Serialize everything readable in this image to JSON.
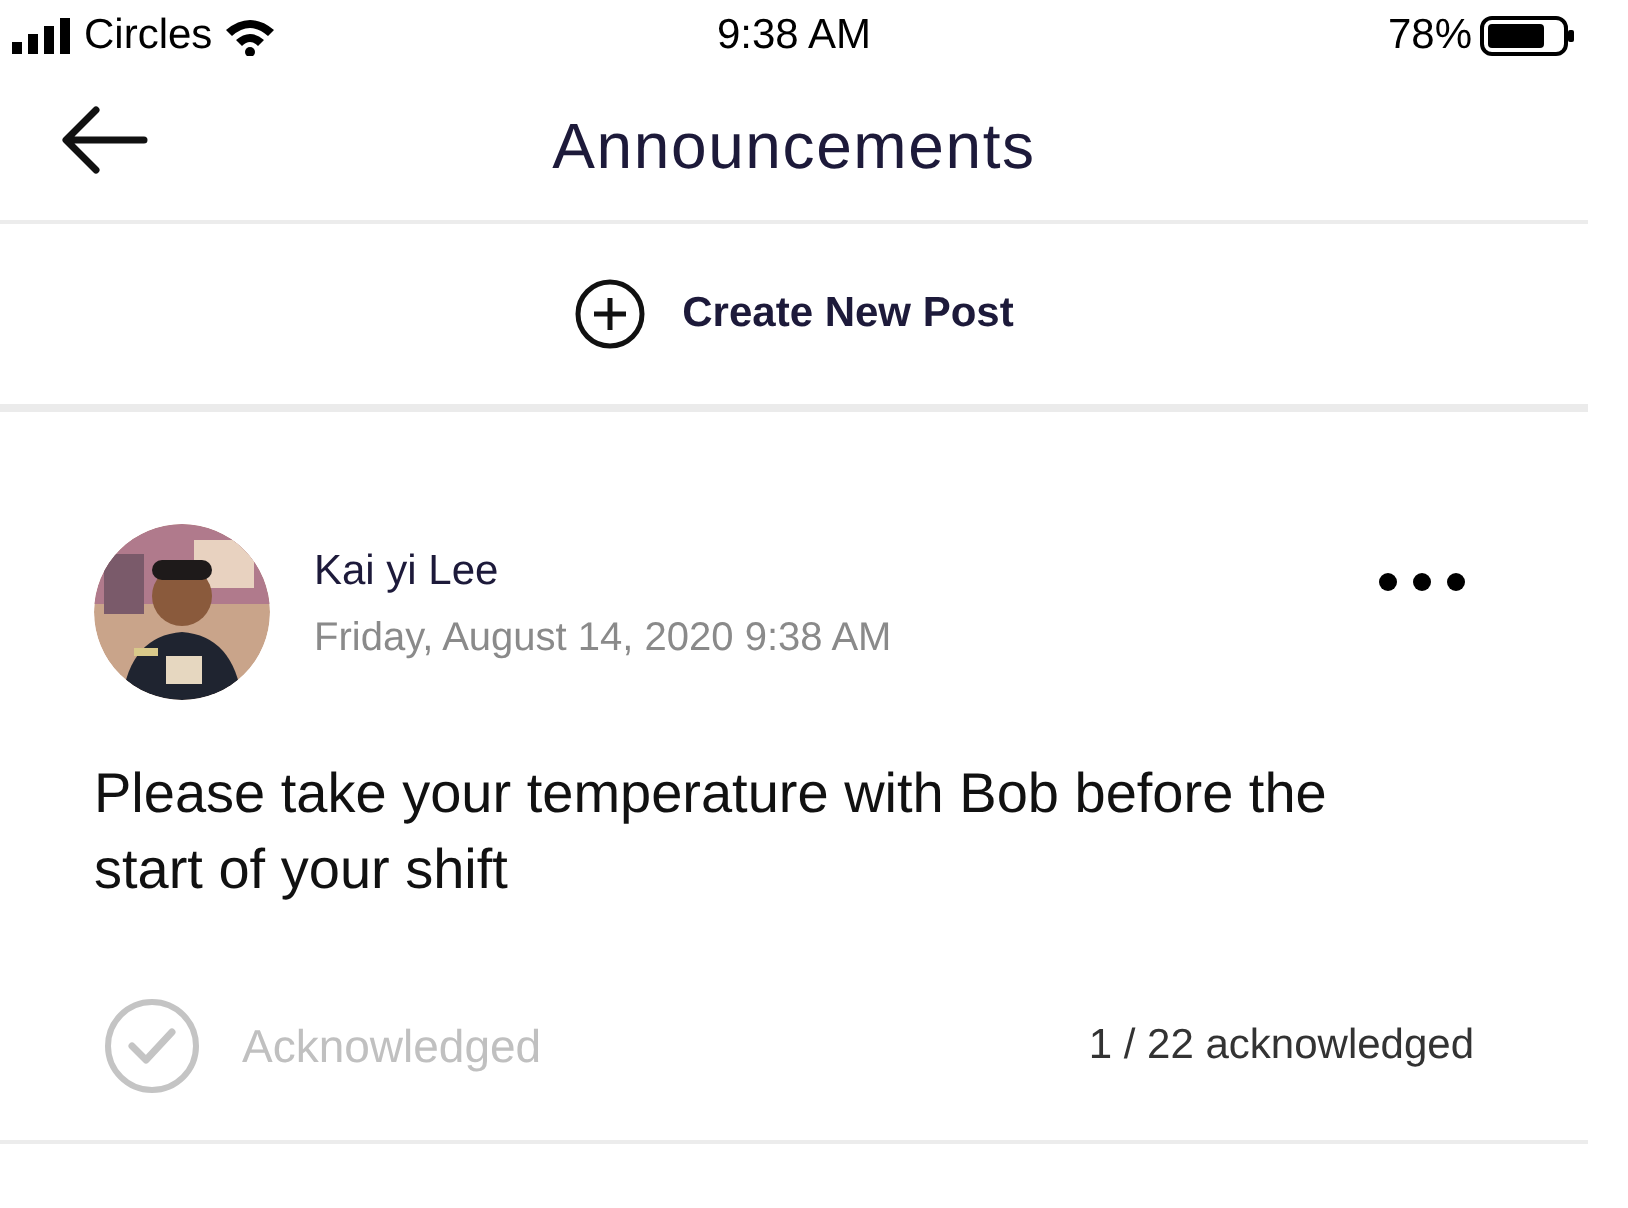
{
  "status_bar": {
    "carrier": "Circles",
    "time": "9:38 AM",
    "battery": "78%"
  },
  "header": {
    "title": "Announcements"
  },
  "create_post": {
    "label": "Create New Post"
  },
  "posts": [
    {
      "author": "Kai yi Lee",
      "timestamp": "Friday, August 14, 2020 9:38 AM",
      "body": "Please take your temperature with Bob before the start of your shift",
      "acknowledged": false,
      "ack_label": "Acknowledged",
      "ack_count": "1 / 22 acknowledged"
    }
  ]
}
